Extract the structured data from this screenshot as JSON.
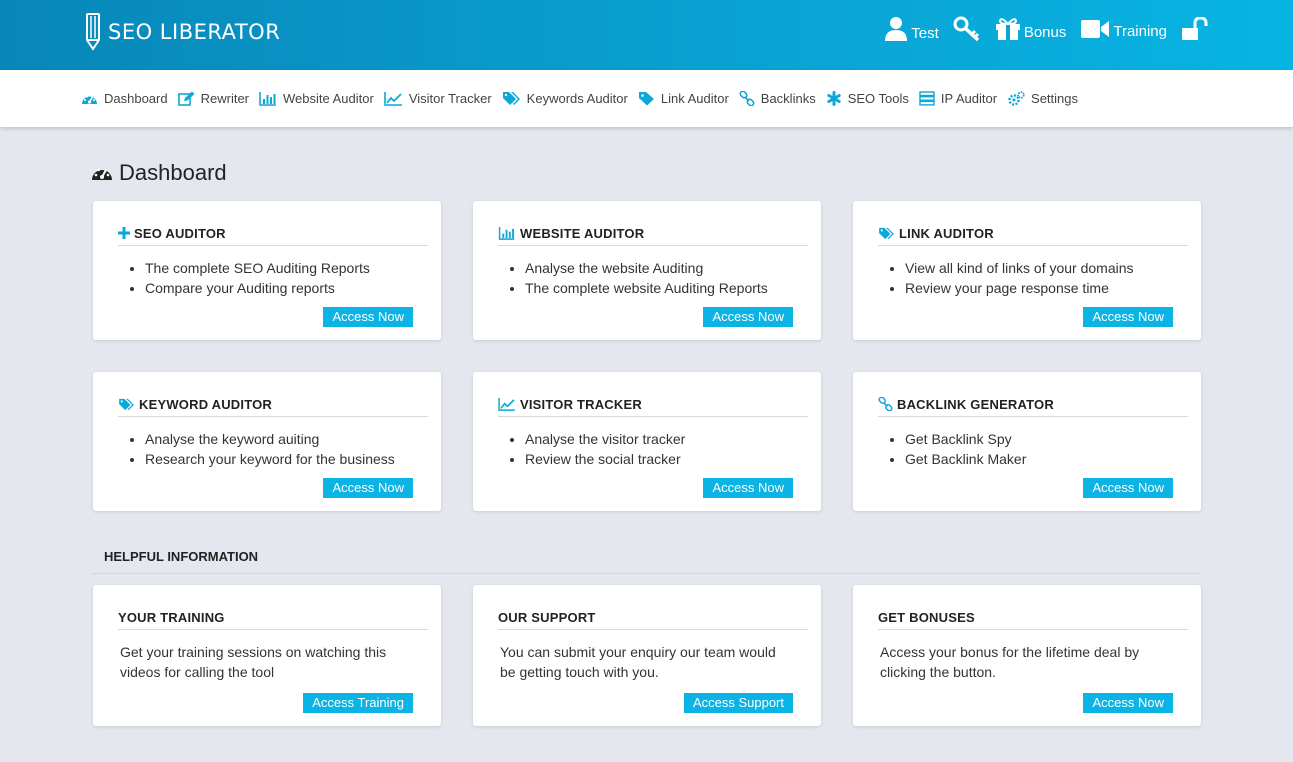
{
  "brand": {
    "name": "SEO LIBERATOR"
  },
  "top_actions": [
    {
      "label": "Test",
      "icon": "user-icon"
    },
    {
      "label": "",
      "icon": "key-icon"
    },
    {
      "label": "Bonus",
      "icon": "gift-icon"
    },
    {
      "label": "Training",
      "icon": "video-icon"
    },
    {
      "label": "",
      "icon": "unlock-icon"
    }
  ],
  "nav": [
    {
      "label": "Dashboard",
      "icon": "dashboard-icon"
    },
    {
      "label": "Rewriter",
      "icon": "edit-icon"
    },
    {
      "label": "Website Auditor",
      "icon": "bar-chart-icon"
    },
    {
      "label": "Visitor Tracker",
      "icon": "line-chart-icon"
    },
    {
      "label": "Keywords Auditor",
      "icon": "tags-icon"
    },
    {
      "label": "Link Auditor",
      "icon": "tag-icon"
    },
    {
      "label": "Backlinks",
      "icon": "link-icon"
    },
    {
      "label": "SEO Tools",
      "icon": "asterisk-icon"
    },
    {
      "label": "IP Auditor",
      "icon": "server-icon"
    },
    {
      "label": "Settings",
      "icon": "gears-icon"
    }
  ],
  "page_title": "Dashboard",
  "cards": [
    {
      "title": "SEO AUDITOR",
      "icon": "plus-icon",
      "items": [
        "The complete SEO Auditing Reports",
        "Compare your Auditing reports"
      ],
      "button": "Access Now"
    },
    {
      "title": "WEBSITE AUDITOR",
      "icon": "bar-chart-icon",
      "items": [
        "Analyse the website Auditing",
        "The complete website Auditing Reports"
      ],
      "button": "Access Now"
    },
    {
      "title": "LINK AUDITOR",
      "icon": "tags-icon",
      "items": [
        "View all kind of links of your domains",
        "Review your page response time"
      ],
      "button": "Access Now"
    },
    {
      "title": "KEYWORD AUDITOR",
      "icon": "tags-icon",
      "items": [
        "Analyse the keyword auiting",
        "Research your keyword for the business"
      ],
      "button": "Access Now"
    },
    {
      "title": "VISITOR TRACKER",
      "icon": "line-chart-icon",
      "items": [
        "Analyse the visitor tracker",
        "Review the social tracker"
      ],
      "button": "Access Now"
    },
    {
      "title": "BACKLINK GENERATOR",
      "icon": "link-icon",
      "items": [
        "Get Backlink Spy",
        "Get Backlink Maker"
      ],
      "button": "Access Now"
    }
  ],
  "helpful": {
    "label": "HELPFUL INFORMATION",
    "cards": [
      {
        "title": "YOUR TRAINING",
        "text": "Get your training sessions on watching this videos for calling the tool",
        "button": "Access Training"
      },
      {
        "title": "OUR SUPPORT",
        "text": "You can submit your enquiry our team would be getting touch with you.",
        "button": "Access Support"
      },
      {
        "title": "GET BONUSES",
        "text": "Access your bonus for the lifetime deal by clicking the button.",
        "button": "Access Now"
      }
    ]
  },
  "colors": {
    "accent": "#0bb4e4",
    "header_start": "#0787b8",
    "header_end": "#06b4e2",
    "background": "#e4e8ee"
  }
}
